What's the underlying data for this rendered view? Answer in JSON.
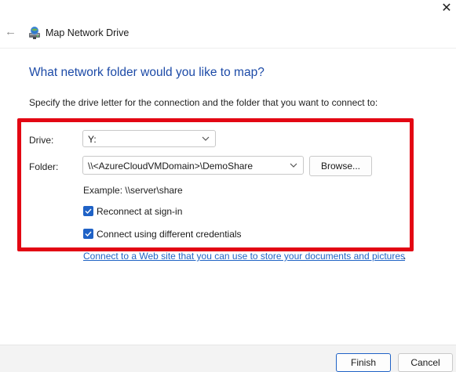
{
  "window": {
    "title": "Map Network Drive",
    "close_glyph": "✕",
    "back_glyph": "←"
  },
  "page": {
    "heading": "What network folder would you like to map?",
    "description": "Specify the drive letter for the connection and the folder that you want to connect to:"
  },
  "form": {
    "drive_label": "Drive:",
    "drive_value": "Y:",
    "folder_label": "Folder:",
    "folder_value": "\\\\<AzureCloudVMDomain>\\DemoShare",
    "browse_label": "Browse...",
    "example_text": "Example: \\\\server\\share",
    "reconnect_label": "Reconnect at sign-in",
    "reconnect_checked": true,
    "credentials_label": "Connect using different credentials",
    "credentials_checked": true
  },
  "link": {
    "text": "Connect to a Web site that you can use to store your documents and pictures",
    "trailing": "."
  },
  "footer": {
    "finish_label": "Finish",
    "cancel_label": "Cancel"
  },
  "colors": {
    "heading": "#1c4aa7",
    "highlight_frame": "#e30613",
    "checkbox": "#1f62c6",
    "link": "#1f63c4"
  },
  "icons": {
    "back": "back-arrow-icon",
    "app": "network-drive-icon",
    "close": "close-icon",
    "dropdown": "chevron-down-icon",
    "check": "checkmark-icon"
  }
}
